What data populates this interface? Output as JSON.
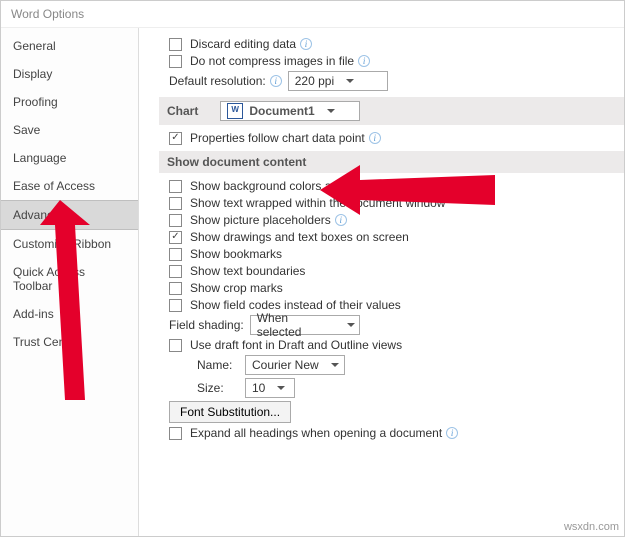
{
  "window": {
    "title": "Word Options"
  },
  "sidebar": {
    "items": [
      {
        "label": "General"
      },
      {
        "label": "Display"
      },
      {
        "label": "Proofing"
      },
      {
        "label": "Save"
      },
      {
        "label": "Language"
      },
      {
        "label": "Ease of Access"
      },
      {
        "label": "Advanced",
        "selected": true
      },
      {
        "label": "Customize Ribbon"
      },
      {
        "label": "Quick Access Toolbar"
      },
      {
        "label": "Add-ins"
      },
      {
        "label": "Trust Center"
      }
    ]
  },
  "top": {
    "discard": "Discard editing data",
    "nocompress": "Do not compress images in file",
    "defres_label": "Default resolution:",
    "defres_value": "220 ppi"
  },
  "chart": {
    "header": "Chart",
    "doc": "Document1",
    "prop": "Properties follow chart data point"
  },
  "content": {
    "header": "Show document content",
    "bg": "Show background colors and images in Print Layout view",
    "wrap": "Show text wrapped within the document window",
    "pic": "Show picture placeholders",
    "draw": "Show drawings and text boxes on screen",
    "bookmarks": "Show bookmarks",
    "textbound": "Show text boundaries",
    "crop": "Show crop marks",
    "fieldcodes": "Show field codes instead of their values",
    "fieldshading_label": "Field shading:",
    "fieldshading_value": "When selected",
    "draftfont": "Use draft font in Draft and Outline views",
    "name_label": "Name:",
    "name_value": "Courier New",
    "size_label": "Size:",
    "size_value": "10",
    "fontsub": "Font Substitution...",
    "expand": "Expand all headings when opening a document"
  },
  "watermark": "wsxdn.com"
}
